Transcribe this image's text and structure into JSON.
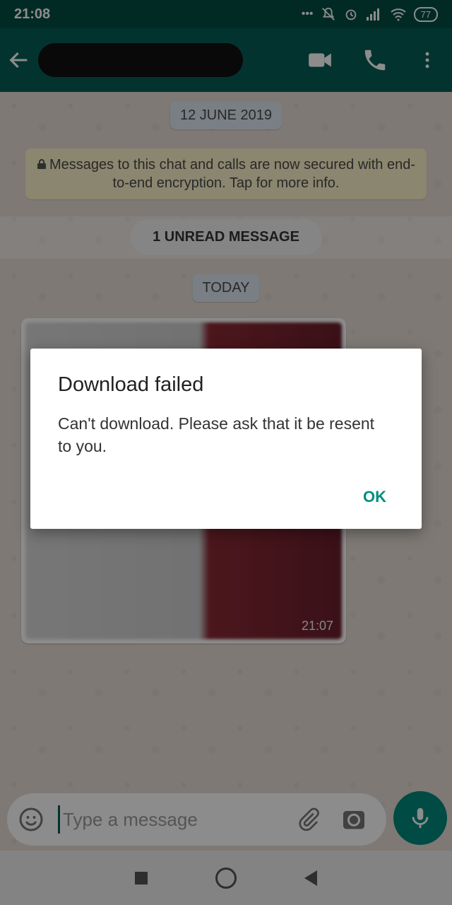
{
  "status_bar": {
    "time": "21:08",
    "battery": "77",
    "icons": [
      "more-dots-icon",
      "mute-icon",
      "alarm-icon",
      "signal-icon",
      "wifi-icon",
      "battery-icon"
    ]
  },
  "toolbar": {
    "contact_name": "",
    "icons": [
      "back-arrow-icon",
      "video-call-icon",
      "voice-call-icon",
      "overflow-menu-icon"
    ]
  },
  "chat": {
    "date_chip": "12 JUNE 2019",
    "encryption_notice": "Messages to this chat and calls are now secured with end-to-end encryption. Tap for more info.",
    "unread_label": "1 UNREAD MESSAGE",
    "today_chip": "TODAY",
    "message": {
      "time": "21:07"
    }
  },
  "dialog": {
    "title": "Download failed",
    "message": "Can't download. Please ask that it be resent to you.",
    "ok_label": "OK"
  },
  "composer": {
    "placeholder": "Type a message"
  },
  "colors": {
    "header": "#075e54",
    "status_bar": "#054d44",
    "accent": "#00897b",
    "dialog_button": "#008d7d"
  }
}
